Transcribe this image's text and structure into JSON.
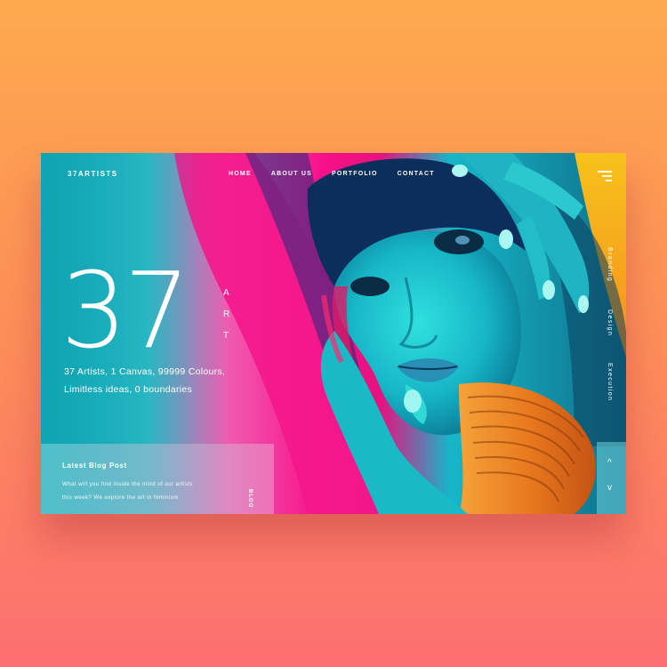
{
  "nav": {
    "brand": "37ARTISTS",
    "links": [
      "HOME",
      "ABOUT US",
      "PORTFOLIO",
      "CONTACT"
    ]
  },
  "hero": {
    "number": "37",
    "art_letters": [
      "A",
      "R",
      "T"
    ],
    "tagline_line1": "37 Artists, 1 Canvas, 99999 Colours,",
    "tagline_line2": "Limitless ideas, 0 boundaries"
  },
  "side_labels": [
    "Branding",
    "Design",
    "Execution"
  ],
  "blog": {
    "title": "Latest Blog Post",
    "line1": "What will you find inside the mind of our artists",
    "line2": "this week? We explore the art in feminism",
    "vertical_label": "BLOG"
  },
  "arrows": {
    "up": "^",
    "down": "v"
  },
  "colors": {
    "page_top": "#fda94d",
    "page_bottom": "#fc6f72",
    "accent_pink": "#f51a8a",
    "accent_cyan": "#2fd7d8"
  }
}
